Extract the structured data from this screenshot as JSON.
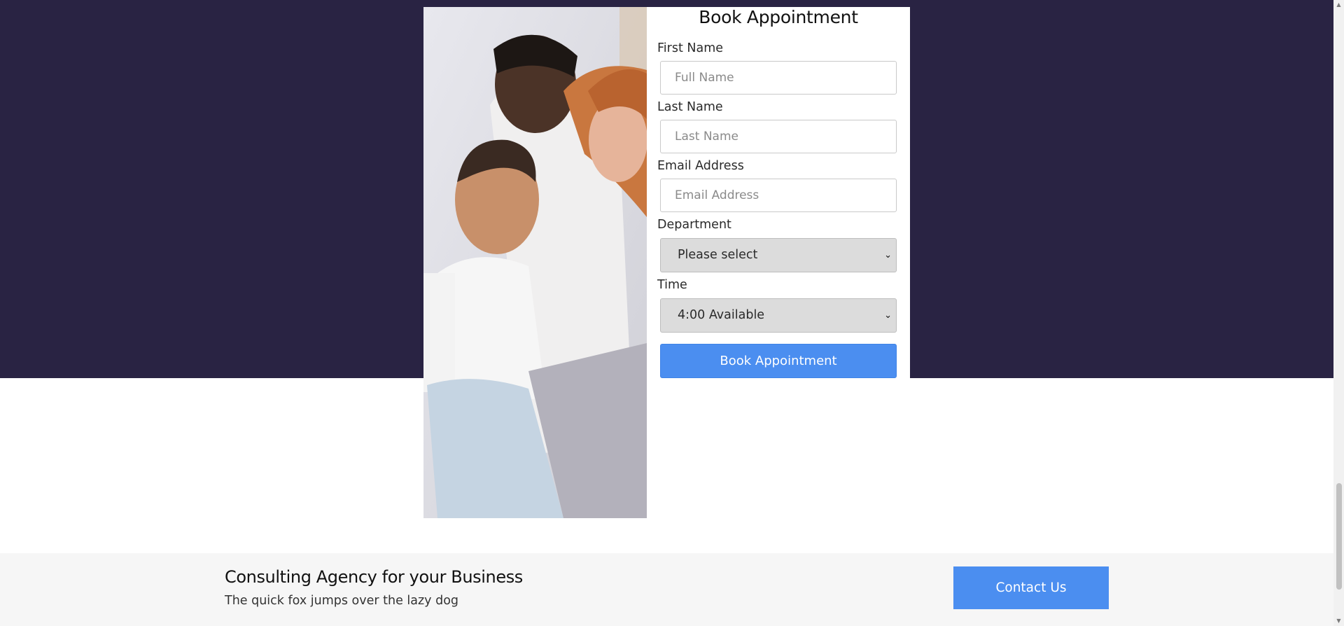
{
  "form": {
    "title": "Book Appointment",
    "first_name": {
      "label": "First Name",
      "placeholder": "Full Name"
    },
    "last_name": {
      "label": "Last Name",
      "placeholder": "Last Name"
    },
    "email": {
      "label": "Email Address",
      "placeholder": "Email Address"
    },
    "department": {
      "label": "Department",
      "selected": "Please select"
    },
    "time": {
      "label": "Time",
      "selected": "4:00 Available"
    },
    "submit_label": "Book Appointment"
  },
  "footer": {
    "title": "Consulting Agency for your Business",
    "subtitle": "The quick fox jumps over the lazy dog",
    "contact_label": "Contact Us"
  },
  "colors": {
    "hero_background": "#292343",
    "accent": "#4b8ef0",
    "footer_background": "#f6f6f6"
  },
  "icons": {
    "select_chevron": "chevron-down-icon",
    "scroll_up": "arrow-up-icon",
    "scroll_down": "arrow-down-icon"
  }
}
